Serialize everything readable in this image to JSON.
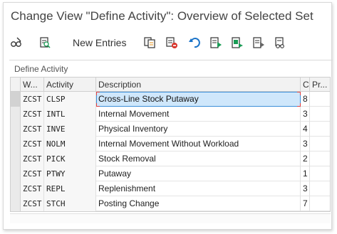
{
  "window": {
    "title": "Change View \"Define Activity\": Overview of Selected Set"
  },
  "toolbar": {
    "new_entries_label": "New Entries"
  },
  "section": {
    "title": "Define Activity"
  },
  "table": {
    "headers": [
      "W...",
      "Activity",
      "Description",
      "C",
      "Pr..."
    ],
    "rows": [
      {
        "w": "ZCST",
        "activity": "CLSP",
        "description": "Cross-Line Stock Putaway",
        "c": "8"
      },
      {
        "w": "ZCST",
        "activity": "INTL",
        "description": "Internal Movement",
        "c": "3"
      },
      {
        "w": "ZCST",
        "activity": "INVE",
        "description": "Physical Inventory",
        "c": "4"
      },
      {
        "w": "ZCST",
        "activity": "NOLM",
        "description": "Internal Movement Without Workload",
        "c": "3"
      },
      {
        "w": "ZCST",
        "activity": "PICK",
        "description": "Stock Removal",
        "c": "2"
      },
      {
        "w": "ZCST",
        "activity": "PTWY",
        "description": "Putaway",
        "c": "1"
      },
      {
        "w": "ZCST",
        "activity": "REPL",
        "description": "Replenishment",
        "c": "3"
      },
      {
        "w": "ZCST",
        "activity": "STCH",
        "description": "Posting Change",
        "c": "7"
      }
    ]
  },
  "colors": {
    "selection": "#cfe7fb",
    "header_bg": "#f2f2f2",
    "accent_blue": "#1a73c8"
  }
}
